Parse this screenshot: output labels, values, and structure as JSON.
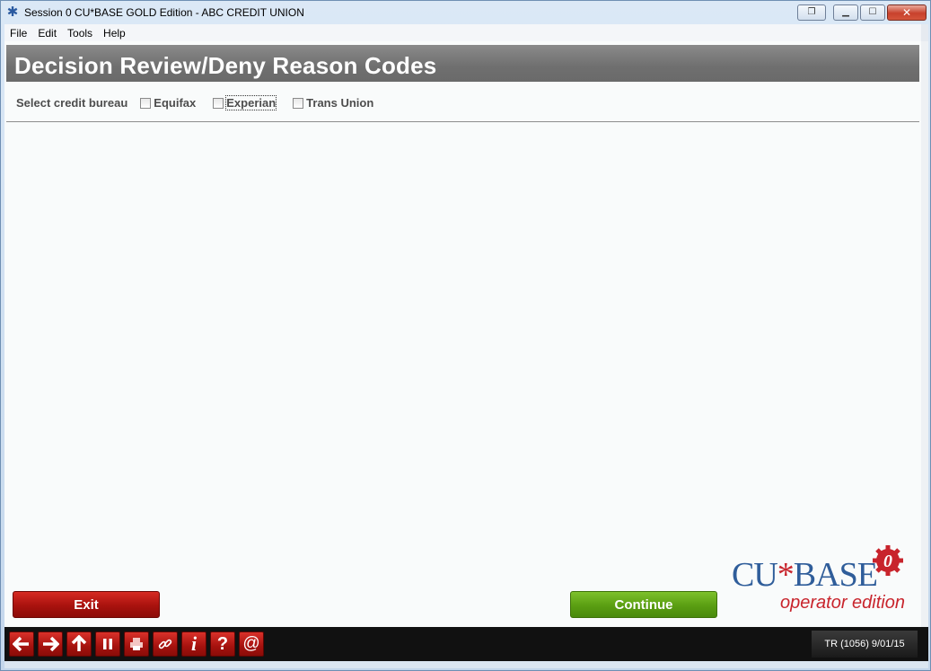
{
  "window": {
    "title": "Session 0 CU*BASE GOLD Edition - ABC CREDIT UNION",
    "app_icon": "cu-asterisk-icon",
    "controls": [
      "restore-icon",
      "minimize-icon",
      "maximize-icon",
      "close-icon"
    ]
  },
  "menu": {
    "items": [
      {
        "label": "File"
      },
      {
        "label": "Edit"
      },
      {
        "label": "Tools"
      },
      {
        "label": "Help"
      }
    ]
  },
  "page": {
    "title": "Decision Review/Deny Reason Codes"
  },
  "bureau": {
    "label": "Select credit bureau",
    "options": [
      {
        "label": "Equifax",
        "checked": false
      },
      {
        "label": "Experian",
        "checked": false,
        "focused": true
      },
      {
        "label": "Trans Union",
        "checked": false
      }
    ]
  },
  "buttons": {
    "exit": "Exit",
    "continue": "Continue",
    "exit_color": "#b5140f",
    "continue_color": "#5a9e12"
  },
  "logo": {
    "brand": "CU*BASE",
    "tagline": "operator edition",
    "gear_digit": "0"
  },
  "toolbar": {
    "icons": [
      "back-arrow-icon",
      "forward-arrow-icon",
      "up-arrow-icon",
      "pause-icon",
      "print-icon",
      "link-icon",
      "info-icon",
      "help-icon",
      "email-icon"
    ],
    "status": "TR (1056) 9/01/15"
  },
  "colors": {
    "header_band": "#787878",
    "accent_red": "#c8242c",
    "brand_blue": "#2f5d9a"
  }
}
